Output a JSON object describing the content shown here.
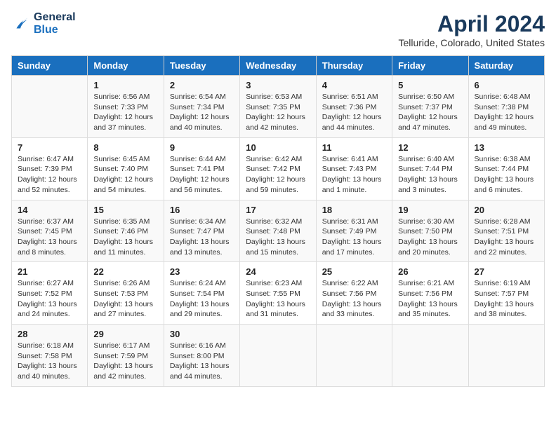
{
  "header": {
    "logo_line1": "General",
    "logo_line2": "Blue",
    "title": "April 2024",
    "subtitle": "Telluride, Colorado, United States"
  },
  "weekdays": [
    "Sunday",
    "Monday",
    "Tuesday",
    "Wednesday",
    "Thursday",
    "Friday",
    "Saturday"
  ],
  "weeks": [
    [
      {
        "day": "",
        "sunrise": "",
        "sunset": "",
        "daylight": ""
      },
      {
        "day": "1",
        "sunrise": "Sunrise: 6:56 AM",
        "sunset": "Sunset: 7:33 PM",
        "daylight": "Daylight: 12 hours and 37 minutes."
      },
      {
        "day": "2",
        "sunrise": "Sunrise: 6:54 AM",
        "sunset": "Sunset: 7:34 PM",
        "daylight": "Daylight: 12 hours and 40 minutes."
      },
      {
        "day": "3",
        "sunrise": "Sunrise: 6:53 AM",
        "sunset": "Sunset: 7:35 PM",
        "daylight": "Daylight: 12 hours and 42 minutes."
      },
      {
        "day": "4",
        "sunrise": "Sunrise: 6:51 AM",
        "sunset": "Sunset: 7:36 PM",
        "daylight": "Daylight: 12 hours and 44 minutes."
      },
      {
        "day": "5",
        "sunrise": "Sunrise: 6:50 AM",
        "sunset": "Sunset: 7:37 PM",
        "daylight": "Daylight: 12 hours and 47 minutes."
      },
      {
        "day": "6",
        "sunrise": "Sunrise: 6:48 AM",
        "sunset": "Sunset: 7:38 PM",
        "daylight": "Daylight: 12 hours and 49 minutes."
      }
    ],
    [
      {
        "day": "7",
        "sunrise": "Sunrise: 6:47 AM",
        "sunset": "Sunset: 7:39 PM",
        "daylight": "Daylight: 12 hours and 52 minutes."
      },
      {
        "day": "8",
        "sunrise": "Sunrise: 6:45 AM",
        "sunset": "Sunset: 7:40 PM",
        "daylight": "Daylight: 12 hours and 54 minutes."
      },
      {
        "day": "9",
        "sunrise": "Sunrise: 6:44 AM",
        "sunset": "Sunset: 7:41 PM",
        "daylight": "Daylight: 12 hours and 56 minutes."
      },
      {
        "day": "10",
        "sunrise": "Sunrise: 6:42 AM",
        "sunset": "Sunset: 7:42 PM",
        "daylight": "Daylight: 12 hours and 59 minutes."
      },
      {
        "day": "11",
        "sunrise": "Sunrise: 6:41 AM",
        "sunset": "Sunset: 7:43 PM",
        "daylight": "Daylight: 13 hours and 1 minute."
      },
      {
        "day": "12",
        "sunrise": "Sunrise: 6:40 AM",
        "sunset": "Sunset: 7:44 PM",
        "daylight": "Daylight: 13 hours and 3 minutes."
      },
      {
        "day": "13",
        "sunrise": "Sunrise: 6:38 AM",
        "sunset": "Sunset: 7:44 PM",
        "daylight": "Daylight: 13 hours and 6 minutes."
      }
    ],
    [
      {
        "day": "14",
        "sunrise": "Sunrise: 6:37 AM",
        "sunset": "Sunset: 7:45 PM",
        "daylight": "Daylight: 13 hours and 8 minutes."
      },
      {
        "day": "15",
        "sunrise": "Sunrise: 6:35 AM",
        "sunset": "Sunset: 7:46 PM",
        "daylight": "Daylight: 13 hours and 11 minutes."
      },
      {
        "day": "16",
        "sunrise": "Sunrise: 6:34 AM",
        "sunset": "Sunset: 7:47 PM",
        "daylight": "Daylight: 13 hours and 13 minutes."
      },
      {
        "day": "17",
        "sunrise": "Sunrise: 6:32 AM",
        "sunset": "Sunset: 7:48 PM",
        "daylight": "Daylight: 13 hours and 15 minutes."
      },
      {
        "day": "18",
        "sunrise": "Sunrise: 6:31 AM",
        "sunset": "Sunset: 7:49 PM",
        "daylight": "Daylight: 13 hours and 17 minutes."
      },
      {
        "day": "19",
        "sunrise": "Sunrise: 6:30 AM",
        "sunset": "Sunset: 7:50 PM",
        "daylight": "Daylight: 13 hours and 20 minutes."
      },
      {
        "day": "20",
        "sunrise": "Sunrise: 6:28 AM",
        "sunset": "Sunset: 7:51 PM",
        "daylight": "Daylight: 13 hours and 22 minutes."
      }
    ],
    [
      {
        "day": "21",
        "sunrise": "Sunrise: 6:27 AM",
        "sunset": "Sunset: 7:52 PM",
        "daylight": "Daylight: 13 hours and 24 minutes."
      },
      {
        "day": "22",
        "sunrise": "Sunrise: 6:26 AM",
        "sunset": "Sunset: 7:53 PM",
        "daylight": "Daylight: 13 hours and 27 minutes."
      },
      {
        "day": "23",
        "sunrise": "Sunrise: 6:24 AM",
        "sunset": "Sunset: 7:54 PM",
        "daylight": "Daylight: 13 hours and 29 minutes."
      },
      {
        "day": "24",
        "sunrise": "Sunrise: 6:23 AM",
        "sunset": "Sunset: 7:55 PM",
        "daylight": "Daylight: 13 hours and 31 minutes."
      },
      {
        "day": "25",
        "sunrise": "Sunrise: 6:22 AM",
        "sunset": "Sunset: 7:56 PM",
        "daylight": "Daylight: 13 hours and 33 minutes."
      },
      {
        "day": "26",
        "sunrise": "Sunrise: 6:21 AM",
        "sunset": "Sunset: 7:56 PM",
        "daylight": "Daylight: 13 hours and 35 minutes."
      },
      {
        "day": "27",
        "sunrise": "Sunrise: 6:19 AM",
        "sunset": "Sunset: 7:57 PM",
        "daylight": "Daylight: 13 hours and 38 minutes."
      }
    ],
    [
      {
        "day": "28",
        "sunrise": "Sunrise: 6:18 AM",
        "sunset": "Sunset: 7:58 PM",
        "daylight": "Daylight: 13 hours and 40 minutes."
      },
      {
        "day": "29",
        "sunrise": "Sunrise: 6:17 AM",
        "sunset": "Sunset: 7:59 PM",
        "daylight": "Daylight: 13 hours and 42 minutes."
      },
      {
        "day": "30",
        "sunrise": "Sunrise: 6:16 AM",
        "sunset": "Sunset: 8:00 PM",
        "daylight": "Daylight: 13 hours and 44 minutes."
      },
      {
        "day": "",
        "sunrise": "",
        "sunset": "",
        "daylight": ""
      },
      {
        "day": "",
        "sunrise": "",
        "sunset": "",
        "daylight": ""
      },
      {
        "day": "",
        "sunrise": "",
        "sunset": "",
        "daylight": ""
      },
      {
        "day": "",
        "sunrise": "",
        "sunset": "",
        "daylight": ""
      }
    ]
  ]
}
